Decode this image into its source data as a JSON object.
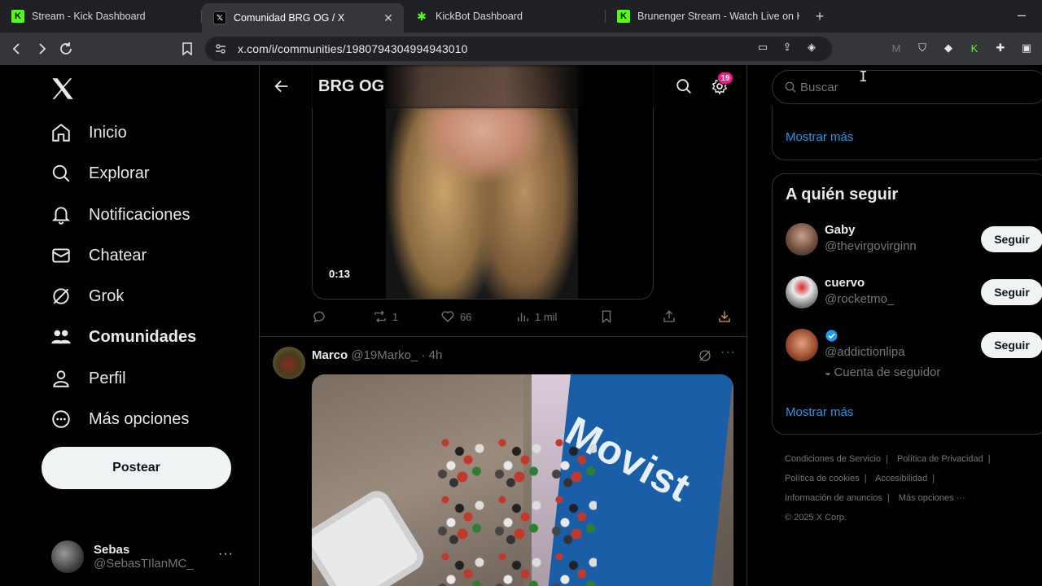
{
  "browser": {
    "tabs": [
      {
        "label": "Stream - Kick Dashboard",
        "icon": "kick-icon",
        "active": false
      },
      {
        "label": "Comunidad BRG OG / X",
        "icon": "x-icon",
        "active": true
      },
      {
        "label": "KickBot Dashboard",
        "icon": "kickbot-icon",
        "active": false
      },
      {
        "label": "Brunenger Stream - Watch Live on Ki",
        "icon": "kick-icon",
        "active": false
      }
    ],
    "url": "x.com/i/communities/1980794304994943010"
  },
  "nav": {
    "items": [
      {
        "label": "Inicio",
        "icon": "home-icon"
      },
      {
        "label": "Explorar",
        "icon": "search-icon"
      },
      {
        "label": "Notificaciones",
        "icon": "bell-icon"
      },
      {
        "label": "Chatear",
        "icon": "mail-icon"
      },
      {
        "label": "Grok",
        "icon": "grok-icon"
      },
      {
        "label": "Comunidades",
        "icon": "communities-icon",
        "active": true
      },
      {
        "label": "Perfil",
        "icon": "person-icon"
      },
      {
        "label": "Más opciones",
        "icon": "more-circle-icon"
      }
    ],
    "post_label": "Postear",
    "profile": {
      "name": "Sebas",
      "handle": "@SebasTIlanMC_"
    }
  },
  "feed": {
    "title": "BRG OG",
    "settings_badge": "19",
    "tweet1": {
      "video_time": "0:13",
      "retweets": "1",
      "likes": "66",
      "views": "1 mil"
    },
    "tweet2": {
      "name": "Marco",
      "handle": "@19Marko_",
      "time": "· 4h"
    }
  },
  "sidebar": {
    "search_placeholder": "Buscar",
    "show_more_1": "Mostrar más",
    "who_to_follow": {
      "title": "A quién seguir",
      "accounts": [
        {
          "name": "Gaby",
          "handle": "@thevirgovirginn"
        },
        {
          "name": "cuervo",
          "handle": "@rocketmo_"
        },
        {
          "name": "",
          "handle": "@addictionlipa",
          "note": "Cuenta de seguidor",
          "verified": true
        }
      ],
      "follow_label": "Seguir",
      "show_more": "Mostrar más"
    },
    "footer": {
      "links": [
        "Condiciones de Servicio",
        "Política de Privacidad",
        "Política de cookies",
        "Accesibilidad",
        "Información de anuncios",
        "Más opciones ···"
      ],
      "copyright": "© 2025 X Corp."
    }
  },
  "colors": {
    "accent": "#1d9bf0",
    "badge": "#f91880",
    "kick": "#53fc18"
  }
}
